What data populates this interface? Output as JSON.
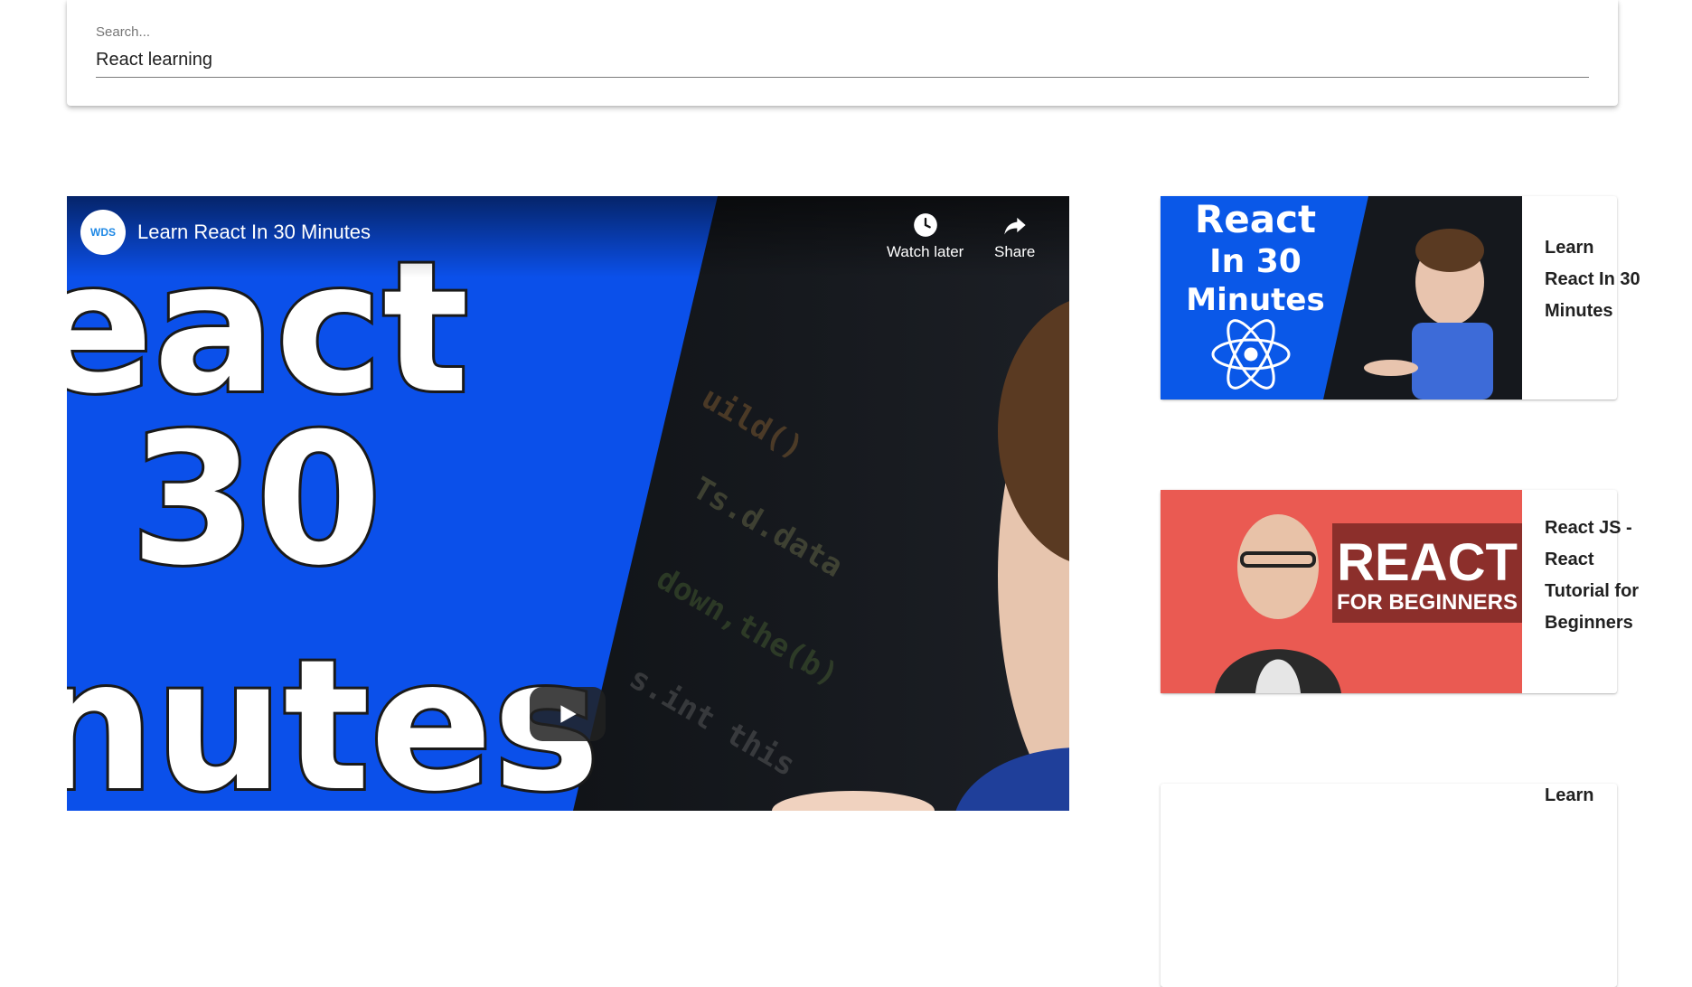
{
  "search": {
    "label": "Search...",
    "value": "React learning"
  },
  "player": {
    "title": "Learn React In 30 Minutes",
    "channel_badge": "WDS",
    "thumb_text_line1": "eact",
    "thumb_text_line2": "30",
    "thumb_text_line3": "nutes",
    "watch_later_label": "Watch later",
    "share_label": "Share",
    "icons": [
      "clock-icon",
      "share-icon",
      "play-icon"
    ]
  },
  "results": [
    {
      "title": "Learn React In 30 Minutes",
      "thumb_lines": [
        "React",
        "In 30",
        "Minutes"
      ],
      "thumb_color": "#0a58e8"
    },
    {
      "title": "React JS - React Tutorial for Beginners",
      "thumb_lines": [
        "REACT",
        "FOR BEGINNERS"
      ],
      "thumb_color": "#ea5a52"
    },
    {
      "title": "Learn",
      "thumb_lines": [],
      "thumb_color": "#ffffff"
    }
  ]
}
